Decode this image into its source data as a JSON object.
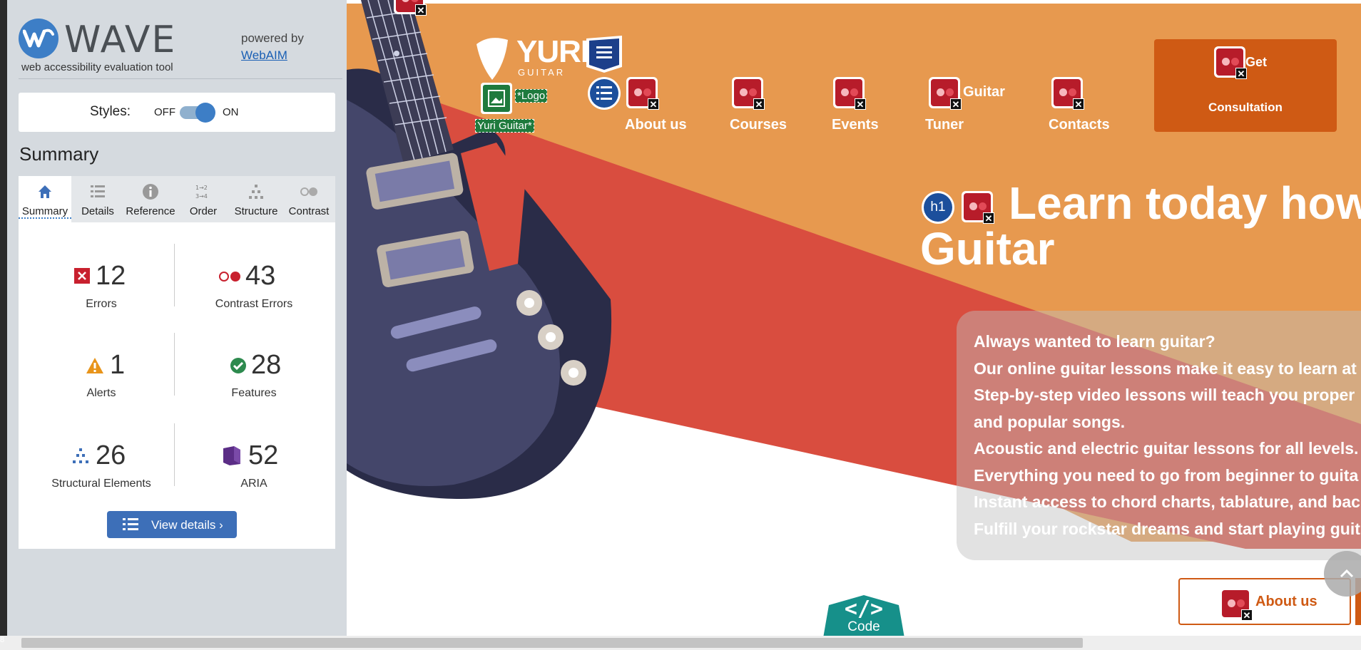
{
  "wave": {
    "brand": "WAVE",
    "tagline": "web accessibility evaluation tool",
    "powered_by": "powered by",
    "powered_link": "WebAIM",
    "styles_label": "Styles:",
    "styles_off": "OFF",
    "styles_on": "ON",
    "summary_heading": "Summary",
    "tabs": [
      {
        "label": "Summary",
        "icon": "home-icon"
      },
      {
        "label": "Details",
        "icon": "list-icon"
      },
      {
        "label": "Reference",
        "icon": "info-icon"
      },
      {
        "label": "Order",
        "icon": "order-icon"
      },
      {
        "label": "Structure",
        "icon": "structure-icon"
      },
      {
        "label": "Contrast",
        "icon": "contrast-icon"
      }
    ],
    "stats": {
      "errors": {
        "value": "12",
        "label": "Errors"
      },
      "contrast": {
        "value": "43",
        "label": "Contrast Errors"
      },
      "alerts": {
        "value": "1",
        "label": "Alerts"
      },
      "features": {
        "value": "28",
        "label": "Features"
      },
      "structural": {
        "value": "26",
        "label": "Structural Elements"
      },
      "aria": {
        "value": "52",
        "label": "ARIA"
      }
    },
    "view_details": "View details ›"
  },
  "site": {
    "logo_brand": "YURI",
    "logo_sub": "GUITAR",
    "logo_alt": "*Logo",
    "logo_text": "Yuri Guitar*",
    "nav": [
      "About us",
      "Courses",
      "Events",
      "Tuner",
      "Contacts"
    ],
    "nav_tuner_top": "Guitar",
    "cta_line1": "Get",
    "cta_line2": "Consultation",
    "h1_badge": "h1",
    "hero_line1": "Learn today how",
    "hero_line2": "Guitar",
    "intro_lines": [
      "Always wanted to learn guitar?",
      "Our online guitar lessons make it easy to learn at",
      "Step-by-step video lessons will teach you proper",
      "and popular songs.",
      "Acoustic and electric guitar lessons for all levels.",
      "Everything you need to go from beginner to guita",
      "Instant access to chord charts, tablature, and bac",
      "Fulfill your rockstar dreams and start playing guit"
    ],
    "about_btn": "About us",
    "code_tab": "Code",
    "code_glyph": "</>"
  },
  "colors": {
    "orange_bg": "#e7994f",
    "orange_dark": "#cf5a14",
    "red_beam": "#d94d3f",
    "wave_blue": "#3d7ec6",
    "error_red": "#b71c2a"
  },
  "corner_label": "8"
}
